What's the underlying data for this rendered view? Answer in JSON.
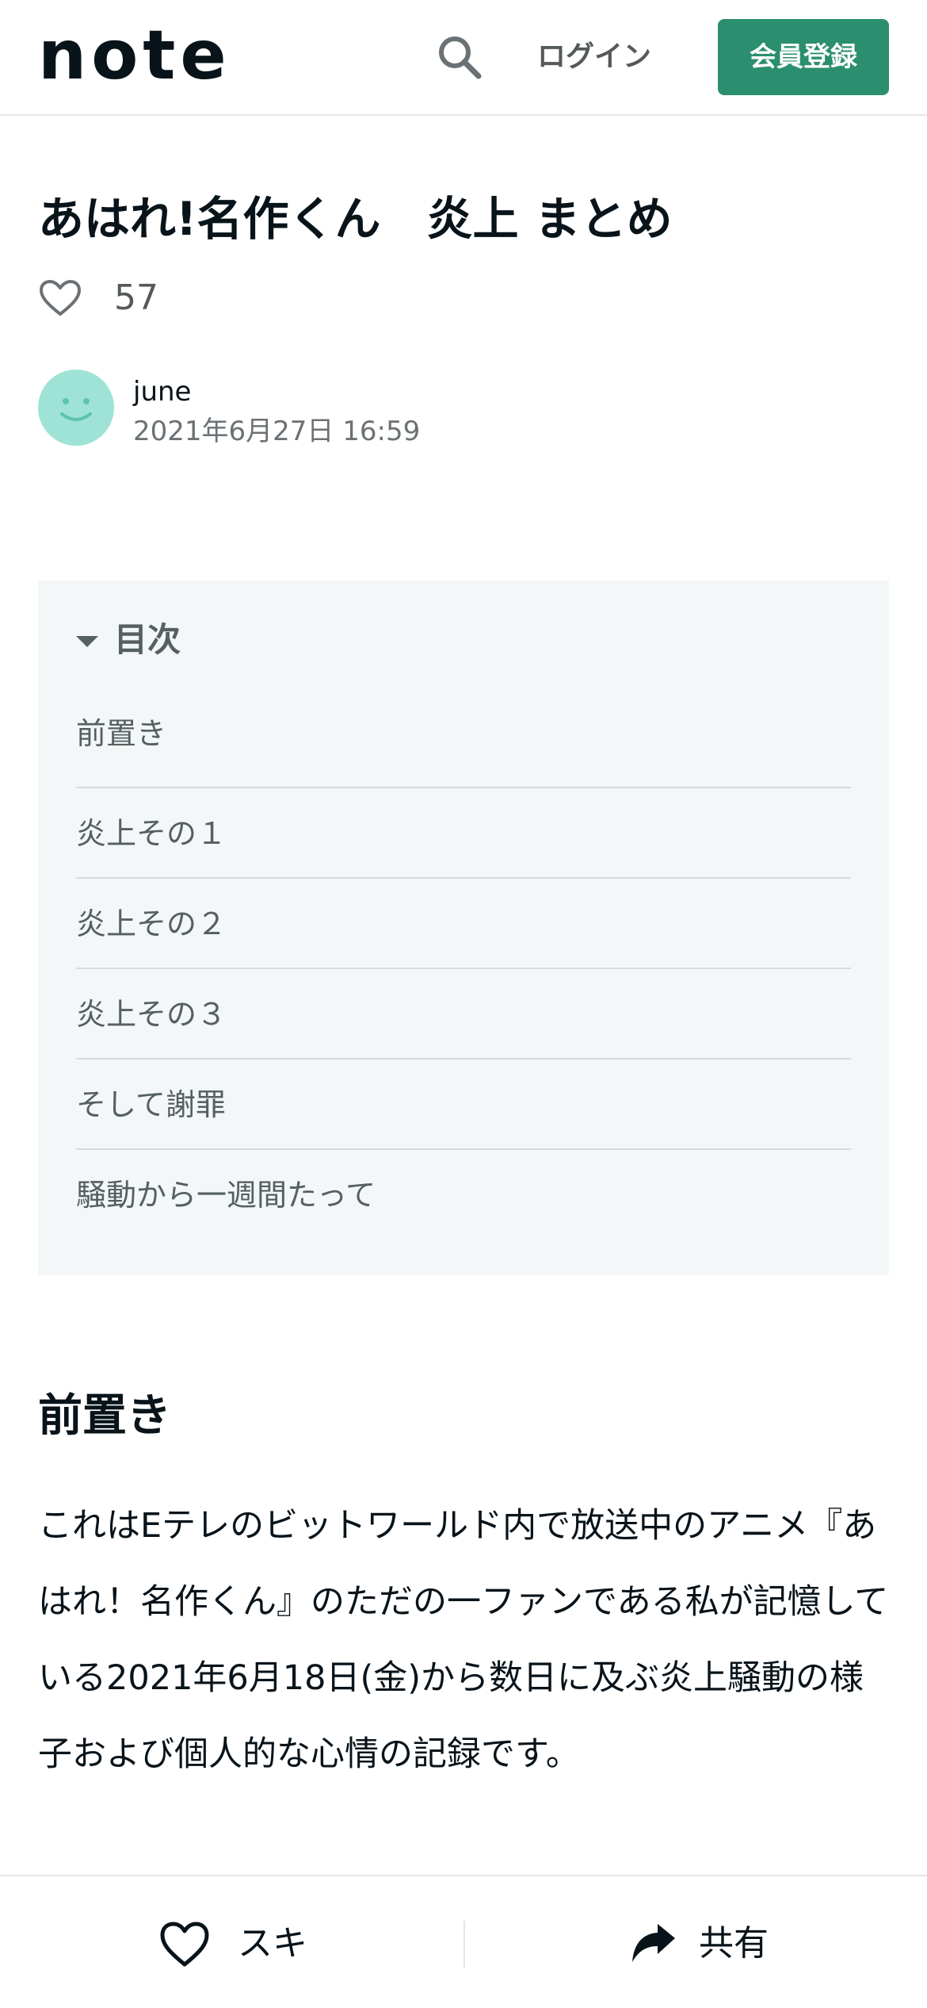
{
  "header": {
    "logo_text": "note",
    "search_icon": "search-icon",
    "login_label": "ログイン",
    "signup_label": "会員登録"
  },
  "article": {
    "title": "あはれ!名作くん　炎上 まとめ",
    "like_count": "57",
    "author_name": "june",
    "posted_at": "2021年6月27日 16:59"
  },
  "toc": {
    "label": "目次",
    "items": [
      "前置き",
      "炎上その１",
      "炎上その２",
      "炎上その３",
      "そして謝罪",
      "騒動から一週間たって"
    ]
  },
  "body": {
    "heading": "前置き",
    "paragraph": "これはEテレのビットワールド内で放送中のアニメ『あはれ！名作くん』のただの一ファンである私が記憶している2021年6月18日(金)から数日に及ぶ炎上騒動の様子および個人的な心情の記録です。"
  },
  "bottom_bar": {
    "like_label": "スキ",
    "share_label": "共有"
  },
  "colors": {
    "accent": "#2a8e6f",
    "avatar": "#9ee3d6",
    "toc_bg": "#f4f7f8"
  }
}
